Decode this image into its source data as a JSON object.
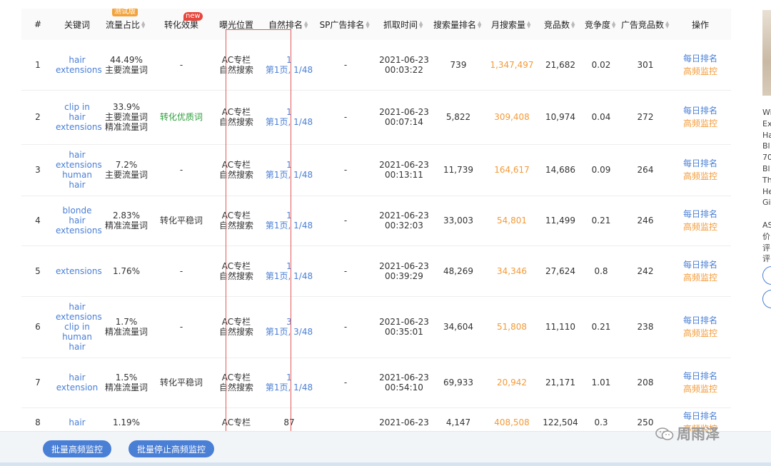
{
  "columns": [
    "#",
    "关键词",
    "流量占比",
    "转化效果",
    "曝光位置",
    "自然排名",
    "SP广告排名",
    "抓取时间",
    "搜索量排名",
    "月搜索量",
    "竞品数",
    "竞争度",
    "广告竞品数",
    "操作"
  ],
  "badges": {
    "test": "测试版",
    "new": "new"
  },
  "rows": [
    {
      "num": "1",
      "keyword": "hair extensions",
      "share": "44.49%",
      "share_type": "主要流量词",
      "conv": "-",
      "exposure1": "AC专栏",
      "exposure2": "自然搜索",
      "rank1": "1",
      "rank2": "第1页, 1/48",
      "sp": "-",
      "date": "2021-06-23",
      "time": "00:03:22",
      "search_rank": "739",
      "monthly": "1,347,497",
      "competitors": "21,682",
      "competition": "0.02",
      "ad_competitors": "301"
    },
    {
      "num": "2",
      "keyword": "clip in hair extensions",
      "share": "33.9%",
      "share_type": "主要流量词 精准流量词",
      "conv": "转化优质词",
      "exposure1": "AC专栏",
      "exposure2": "自然搜索",
      "rank1": "1",
      "rank2": "第1页, 1/48",
      "sp": "-",
      "date": "2021-06-23",
      "time": "00:07:14",
      "search_rank": "5,822",
      "monthly": "309,408",
      "competitors": "10,974",
      "competition": "0.04",
      "ad_competitors": "272"
    },
    {
      "num": "3",
      "keyword": "hair extensions human hair",
      "share": "7.2%",
      "share_type": "主要流量词",
      "conv": "-",
      "exposure1": "AC专栏",
      "exposure2": "自然搜索",
      "rank1": "1",
      "rank2": "第1页, 1/48",
      "sp": "-",
      "date": "2021-06-23",
      "time": "00:13:11",
      "search_rank": "11,739",
      "monthly": "164,617",
      "competitors": "14,686",
      "competition": "0.09",
      "ad_competitors": "264"
    },
    {
      "num": "4",
      "keyword": "blonde hair extensions",
      "share": "2.83%",
      "share_type": "精准流量词",
      "conv": "转化平稳词",
      "exposure1": "AC专栏",
      "exposure2": "自然搜索",
      "rank1": "1",
      "rank2": "第1页, 1/48",
      "sp": "-",
      "date": "2021-06-23",
      "time": "00:32:03",
      "search_rank": "33,003",
      "monthly": "54,801",
      "competitors": "11,499",
      "competition": "0.21",
      "ad_competitors": "246"
    },
    {
      "num": "5",
      "keyword": "extensions",
      "share": "1.76%",
      "share_type": "",
      "conv": "-",
      "exposure1": "AC专栏",
      "exposure2": "自然搜索",
      "rank1": "1",
      "rank2": "第1页, 1/48",
      "sp": "-",
      "date": "2021-06-23",
      "time": "00:39:29",
      "search_rank": "48,269",
      "monthly": "34,346",
      "competitors": "27,624",
      "competition": "0.8",
      "ad_competitors": "242"
    },
    {
      "num": "6",
      "keyword": "hair extensions clip in human hair",
      "share": "1.7%",
      "share_type": "精准流量词",
      "conv": "-",
      "exposure1": "AC专栏",
      "exposure2": "自然搜索",
      "rank1": "3",
      "rank2": "第1页, 3/48",
      "sp": "-",
      "date": "2021-06-23",
      "time": "00:35:01",
      "search_rank": "34,604",
      "monthly": "51,808",
      "competitors": "11,110",
      "competition": "0.21",
      "ad_competitors": "238"
    },
    {
      "num": "7",
      "keyword": "hair extension",
      "share": "1.5%",
      "share_type": "精准流量词",
      "conv": "转化平稳词",
      "exposure1": "AC专栏",
      "exposure2": "自然搜索",
      "rank1": "1",
      "rank2": "第1页, 1/48",
      "sp": "-",
      "date": "2021-06-23",
      "time": "00:54:10",
      "search_rank": "69,933",
      "monthly": "20,942",
      "competitors": "21,171",
      "competition": "1.01",
      "ad_competitors": "208"
    },
    {
      "num": "8",
      "keyword": "hair",
      "share": "1.19%",
      "share_type": "",
      "conv": "",
      "exposure1": "AC专栏",
      "exposure2": "",
      "rank1": "87",
      "rank2": "",
      "sp": "",
      "date": "2021-06-23",
      "time": "",
      "search_rank": "4,147",
      "monthly": "408,508",
      "competitors": "122,504",
      "competition": "0.3",
      "ad_competitors": "250"
    }
  ],
  "ops": {
    "daily_rank": "每日排名",
    "hf_monitor": "高频监控"
  },
  "buttons": {
    "batch_monitor": "批量高频监控",
    "batch_stop": "批量停止高频监控"
  },
  "watermark": "周雨泽",
  "side_text": "Wi\nEx\nHa\nBl\n70\nBl\nTh\nHe\nGi\n\nAS\n价\n评\n评",
  "colors": {
    "link": "#4a7fd6",
    "orange": "#f39a38",
    "green": "#2c9e3b",
    "highlight": "#e05a5a"
  }
}
